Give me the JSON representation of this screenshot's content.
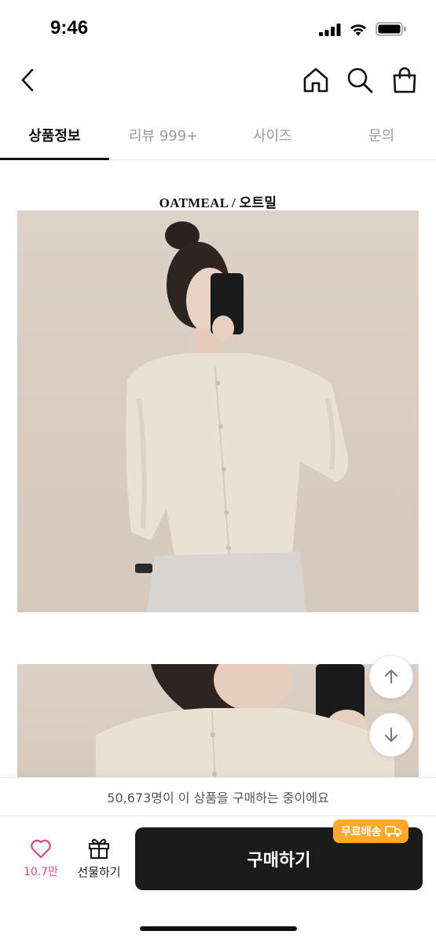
{
  "status_bar": {
    "time": "9:46"
  },
  "header": {
    "back_icon": "chevron-left-icon",
    "home_icon": "home-icon",
    "search_icon": "search-icon",
    "bag_icon": "shopping-bag-icon"
  },
  "tabs": [
    {
      "label": "상품정보",
      "active": true
    },
    {
      "label": "리뷰 999+",
      "active": false
    },
    {
      "label": "사이즈",
      "active": false
    },
    {
      "label": "문의",
      "active": false
    }
  ],
  "product": {
    "color_label": "OATMEAL / 오트밀"
  },
  "scroll": {
    "up_icon": "arrow-up-icon",
    "down_icon": "arrow-down-icon"
  },
  "banner": {
    "text": "50,673명이 이 상품을 구매하는 중이에요"
  },
  "bottom_bar": {
    "like_count": "10.7만",
    "gift_label": "선물하기",
    "buy_label": "구매하기",
    "free_shipping": "무료배송"
  },
  "colors": {
    "accent_pink": "#e0457b",
    "free_ship_orange": "#ffa829",
    "buy_button": "#1b1b1b"
  }
}
